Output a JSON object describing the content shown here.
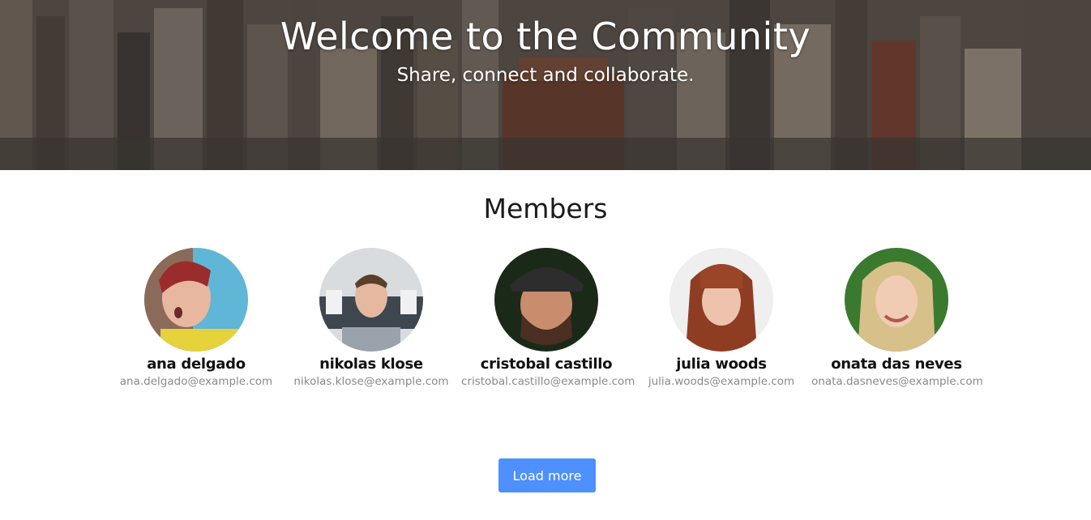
{
  "hero": {
    "title": "Welcome to the Community",
    "subtitle": "Share, connect and collaborate."
  },
  "members_section": {
    "title": "Members",
    "members": [
      {
        "name": "ana delgado",
        "email": "ana.delgado@example.com"
      },
      {
        "name": "nikolas klose",
        "email": "nikolas.klose@example.com"
      },
      {
        "name": "cristobal castillo",
        "email": "cristobal.castillo@example.com"
      },
      {
        "name": "julia woods",
        "email": "julia.woods@example.com"
      },
      {
        "name": "onata das neves",
        "email": "onata.dasneves@example.com"
      }
    ]
  },
  "load_more_label": "Load more",
  "colors": {
    "button_bg": "#4d90fe",
    "email_text": "#8a8a8a"
  }
}
